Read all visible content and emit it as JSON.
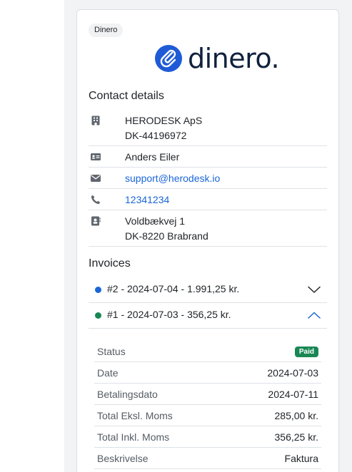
{
  "badge": "Dinero",
  "logo": {
    "text": "dinero.",
    "color": "#1f5bd6"
  },
  "contact": {
    "title": "Contact details",
    "company_name": "HERODESK ApS",
    "company_cvr": "DK-44196972",
    "person": "Anders Eiler",
    "email": "support@herodesk.io",
    "phone": "12341234",
    "address_line1": "Voldbækvej 1",
    "address_line2": "DK-8220 Brabrand"
  },
  "invoices": {
    "title": "Invoices",
    "items": [
      {
        "label": "#2 - 2024-07-04 - 1.991,25 kr.",
        "status_color": "#1a66d9",
        "expanded": false
      },
      {
        "label": "#1 - 2024-07-03 - 356,25 kr.",
        "status_color": "#198754",
        "expanded": true
      }
    ],
    "details": {
      "status_label": "Status",
      "status_value": "Paid",
      "date_label": "Date",
      "date_value": "2024-07-03",
      "due_label": "Betalingsdato",
      "due_value": "2024-07-11",
      "excl_label": "Total Eksl. Moms",
      "excl_value": "285,00 kr.",
      "incl_label": "Total Inkl. Moms",
      "incl_value": "356,25 kr.",
      "desc_label": "Beskrivelse",
      "desc_value": "Faktura"
    }
  }
}
